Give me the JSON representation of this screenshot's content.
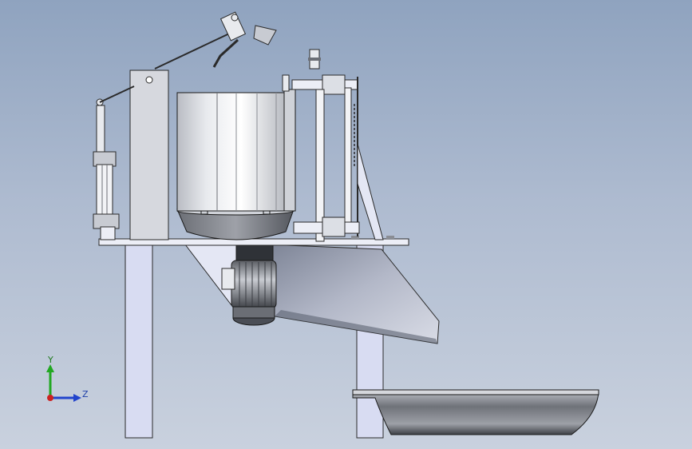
{
  "triad": {
    "y_label": "Y",
    "z_label": "Z",
    "y_color": "#22a822",
    "z_color": "#2244cc",
    "origin_color": "#cc2222"
  },
  "colors": {
    "background_top": "#8fa3bf",
    "background_bottom": "#c9d1de",
    "frame_fill": "#d8dcf2",
    "metal_dark": "#4a4d55",
    "outline": "#2a2a2a"
  }
}
